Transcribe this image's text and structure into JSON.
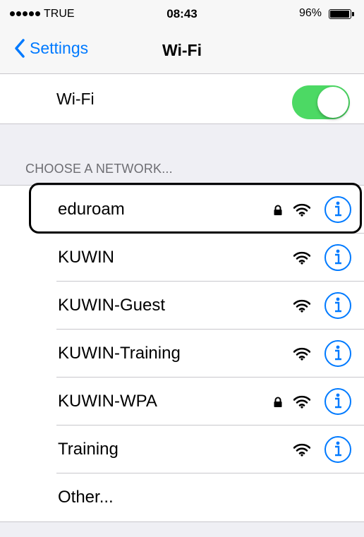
{
  "status_bar": {
    "carrier": "TRUE",
    "time": "08:43",
    "battery_percent": "96%",
    "battery_level": 0.96,
    "signal_dots": 5
  },
  "nav": {
    "back_label": "Settings",
    "title": "Wi-Fi"
  },
  "wifi_toggle": {
    "label": "Wi-Fi",
    "on": true,
    "color": "#4cd964"
  },
  "section_header": "CHOOSE A NETWORK...",
  "networks": [
    {
      "name": "eduroam",
      "locked": true
    },
    {
      "name": "KUWIN",
      "locked": false
    },
    {
      "name": "KUWIN-Guest",
      "locked": false
    },
    {
      "name": "KUWIN-Training",
      "locked": false
    },
    {
      "name": "KUWIN-WPA",
      "locked": true
    },
    {
      "name": "Training",
      "locked": false
    }
  ],
  "other_label": "Other...",
  "accent_color": "#007aff"
}
